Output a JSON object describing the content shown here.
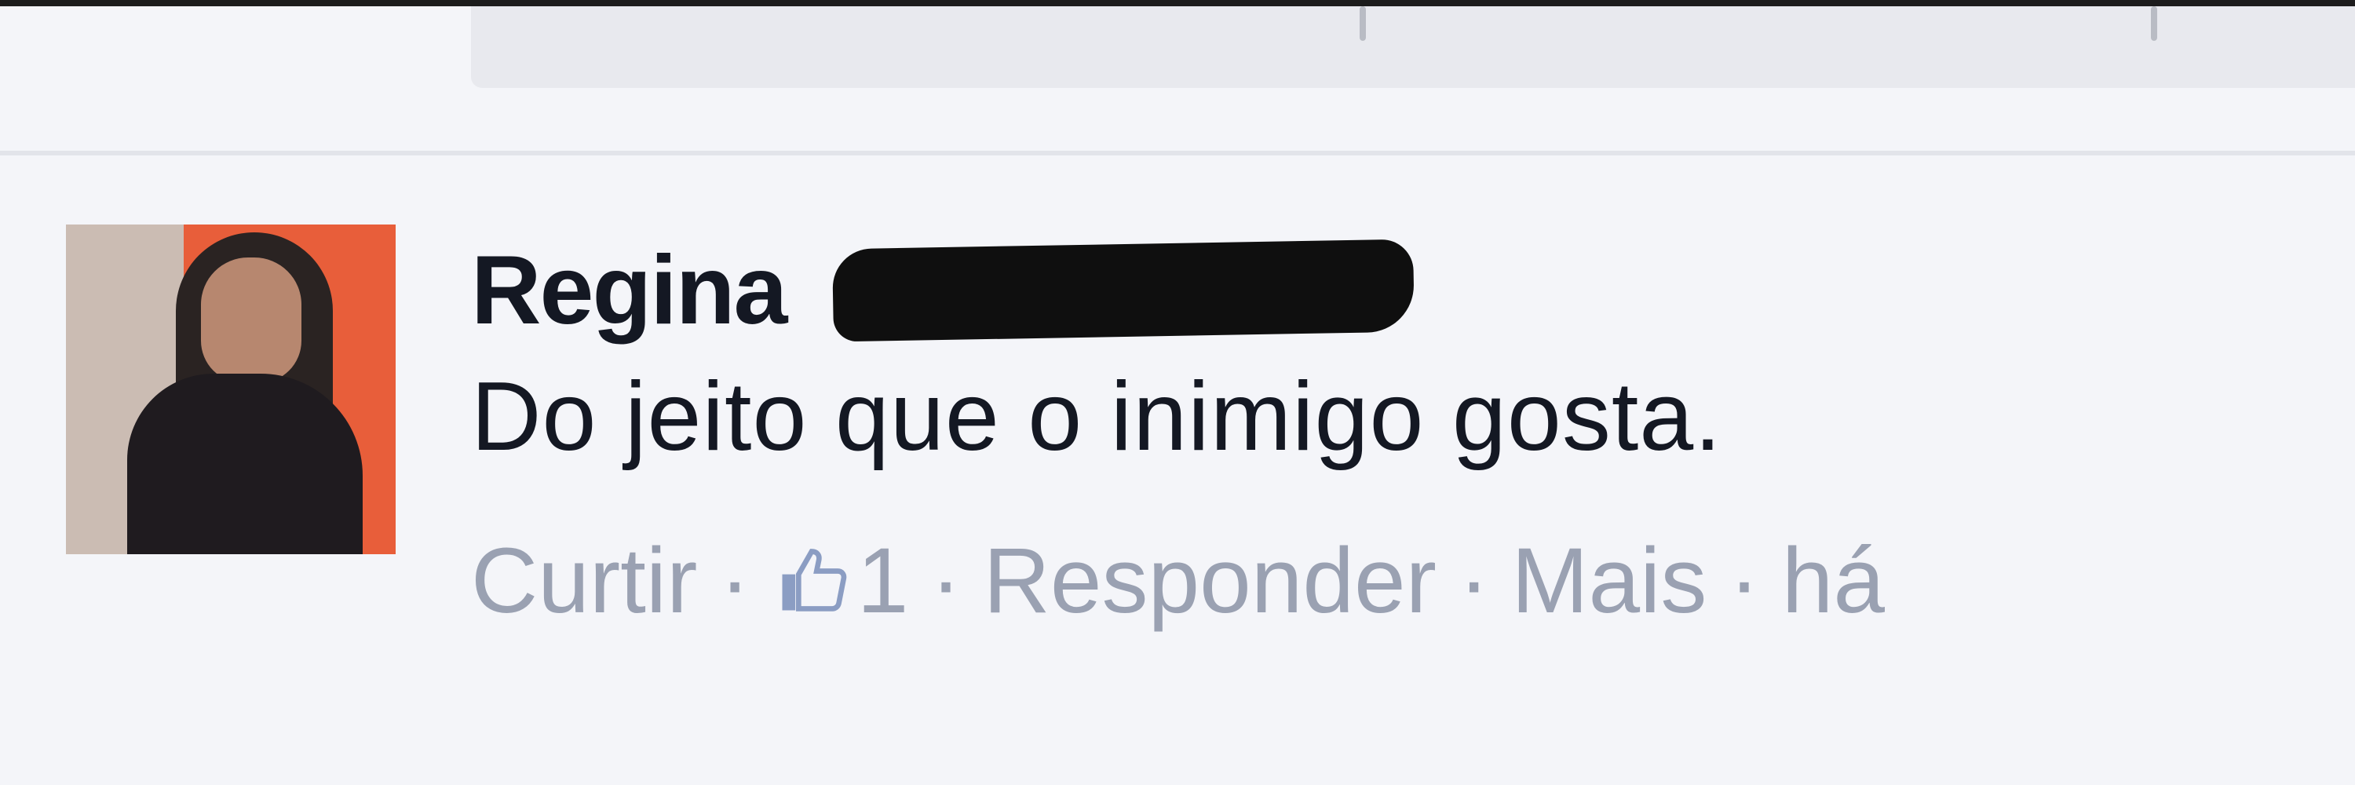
{
  "comment": {
    "author_name": "Regina",
    "text": "Do jeito que o inimigo gosta.",
    "actions": {
      "like_label": "Curtir",
      "separator": "·",
      "like_count": "1",
      "reply_label": "Responder",
      "more_label": "Mais",
      "time_label": "há"
    },
    "icons": {
      "like": "thumbs-up-icon",
      "avatar": "profile-photo"
    }
  }
}
